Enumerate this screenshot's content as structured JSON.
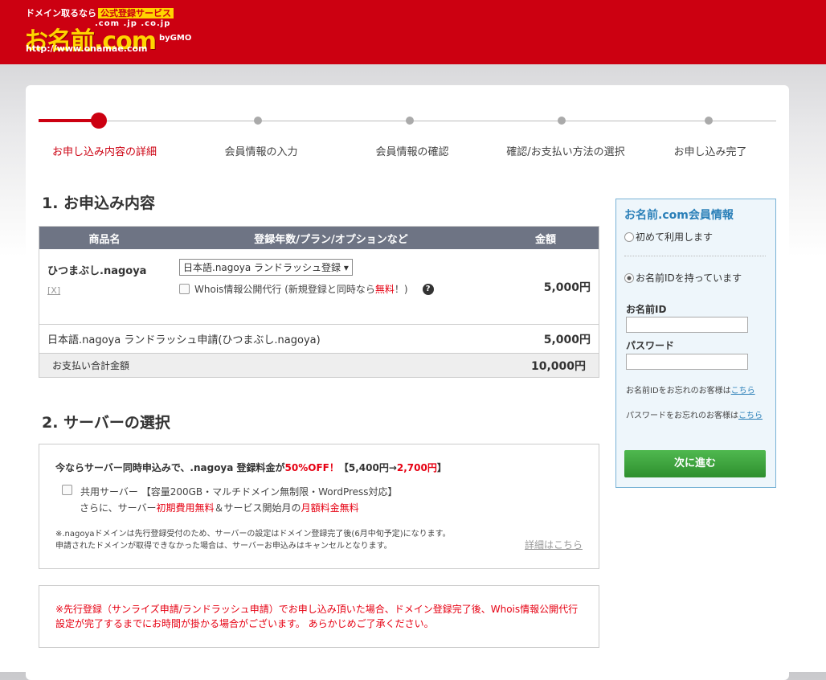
{
  "header": {
    "tagline": "ドメイン取るなら",
    "tagline_badge": "公式登録サービス",
    "tlds": ".com .jp .co.jp",
    "brand": "お名前.com",
    "by": "byGMO",
    "url": "http://www.onamae.com"
  },
  "steps": [
    {
      "label": "お申し込み内容の詳細",
      "active": true
    },
    {
      "label": "会員情報の入力"
    },
    {
      "label": "会員情報の確認"
    },
    {
      "label": "確認/お支払い方法の選択"
    },
    {
      "label": "お申し込み完了"
    }
  ],
  "order": {
    "heading": "1. お申込み内容",
    "columns": [
      "商品名",
      "登録年数/プラン/オプションなど",
      "金額"
    ],
    "item": {
      "name": "ひつまぶし.nagoya",
      "remove": "[X]",
      "plan": "日本語.nagoya ランドラッシュ登録",
      "whois_label": "Whois情報公開代行 (新規登録と同時なら",
      "whois_free": "無料",
      "whois_end": "！)",
      "help": "?",
      "price": "5,000円"
    },
    "item2": {
      "name": "日本語.nagoya ランドラッシュ申請(ひつまぶし.nagoya)",
      "price": "5,000円"
    },
    "total": {
      "label": "お支払い合計金額",
      "price": "10,000円"
    }
  },
  "server": {
    "heading": "2. サーバーの選択",
    "headline_pre": "今ならサーバー同時申込みで、.nagoya 登録料金が",
    "headline_off": "50%OFF！",
    "headline_bracket_open": "【5,400円→",
    "headline_new_price": "2,700円",
    "headline_bracket_close": "】",
    "option": "共用サーバー 【容量200GB・マルチドメイン無制限・WordPress対応】",
    "option2_pre": "さらに、サーバー",
    "option2_red1": "初期費用無料",
    "option2_mid": "＆サービス開始月の",
    "option2_red2": "月額料金無料",
    "note1": "※.nagoyaドメインは先行登録受付のため、サーバーの設定はドメイン登録完了後(6月中旬予定)になります。",
    "note2": "申請されたドメインが取得できなかった場合は、サーバーお申込みはキャンセルとなります。",
    "detail_link": "詳細はこちら"
  },
  "notice": "※先行登録（サンライズ申請/ランドラッシュ申請）でお申し込み頂いた場合、ドメイン登録完了後、Whois情報公開代行設定が完了するまでにお時間が掛かる場合がございます。 あらかじめご了承ください。",
  "member": {
    "title": "お名前.com会員情報",
    "radio_first": "初めて利用します",
    "radio_have": "お名前IDを持っています",
    "id_label": "お名前ID",
    "pw_label": "パスワード",
    "forgot_id": "お名前IDをお忘れのお客様は",
    "forgot_pw": "パスワードをお忘れのお客様は",
    "here": "こちら",
    "next": "次に進む"
  },
  "colors": {
    "brand_red": "#cc0011",
    "accent_blue": "#2a7fb8",
    "button_green": "#3aa33a"
  }
}
